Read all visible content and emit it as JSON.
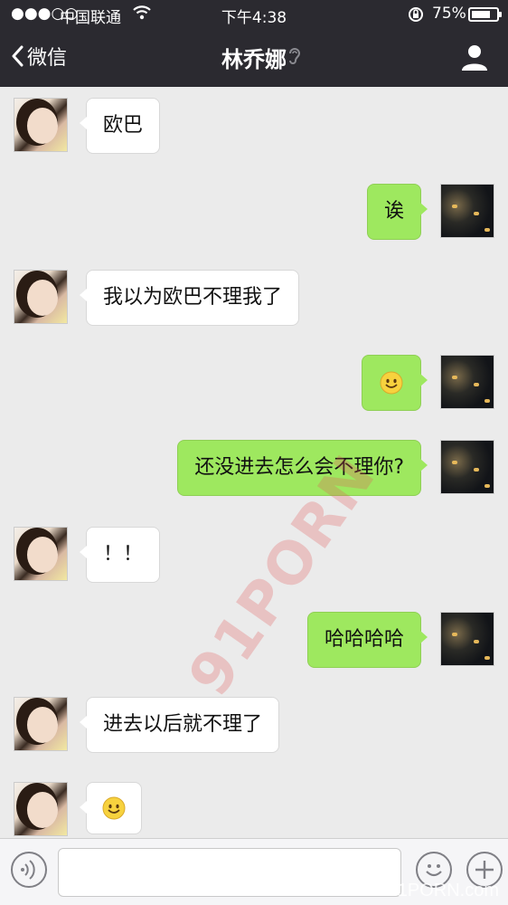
{
  "status_bar": {
    "signal": "●●●○○",
    "carrier": "中国联通",
    "time": "下午4:38",
    "battery_percent": "75%",
    "battery_level": 0.75
  },
  "nav": {
    "back_label": "微信",
    "title": "林乔娜"
  },
  "messages": [
    {
      "side": "left",
      "text": "欧巴"
    },
    {
      "side": "right",
      "text": "诶"
    },
    {
      "side": "left",
      "text": "我以为欧巴不理我了"
    },
    {
      "side": "right",
      "text": "",
      "emoji": "smile-emoji"
    },
    {
      "side": "right",
      "text": "还没进去怎么会不理你?"
    },
    {
      "side": "left",
      "text": "！！"
    },
    {
      "side": "right",
      "text": "哈哈哈哈"
    },
    {
      "side": "left",
      "text": "进去以后就不理了"
    },
    {
      "side": "left",
      "text": "",
      "emoji": "smile-emoji"
    }
  ],
  "watermark": "91PORN",
  "watermark_corner": "91PORN.com",
  "colors": {
    "bar_bg": "#2b2a30",
    "chat_bg": "#ebebeb",
    "my_bubble": "#9ee85f",
    "their_bubble": "#ffffff"
  },
  "icons": {
    "voice": "voice-input-icon",
    "emoji": "emoji-icon",
    "plus": "add-icon",
    "contact": "contact-info-icon",
    "ear": "earpiece-mode-icon"
  }
}
